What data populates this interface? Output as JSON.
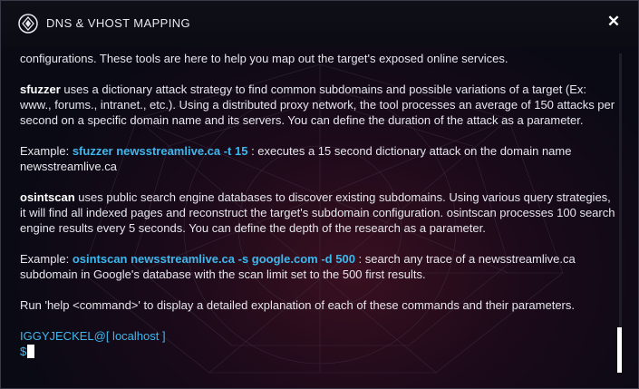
{
  "window": {
    "title": "DNS & VHOST MAPPING",
    "close_symbol": "✕"
  },
  "content": {
    "intro": "configurations. These tools are here to help you map out the target's exposed online services.",
    "sfuzzer": {
      "name": "sfuzzer",
      "desc": " uses a dictionary attack strategy to find common subdomains and possible variations of a target (Ex: www., forums., intranet., etc.). Using a distributed proxy network, the tool processes an average of 150 attacks per second on a specific domain name and its servers. You can define the duration of the attack as a parameter.",
      "example_label": "Example: ",
      "example_cmd": "sfuzzer newsstreamlive.ca -t 15",
      "example_desc": " : executes a 15 second dictionary attack on the domain name newsstreamlive.ca"
    },
    "osintscan": {
      "name": "osintscan",
      "desc": " uses public search engine databases to discover existing subdomains. Using various query strategies, it will find all indexed pages and reconstruct the target's subdomain configuration. osintscan processes 100 search engine results every 5 seconds. You can define the depth of the research as a parameter.",
      "example_label": "Example: ",
      "example_cmd": "osintscan newsstreamlive.ca -s google.com -d 500",
      "example_desc": " : search any trace of a newsstreamlive.ca subdomain in Google's database with the scan limit set to the 500 first results."
    },
    "help_hint": "Run 'help <command>' to display a detailed explanation of each of these commands and their parameters."
  },
  "terminal": {
    "prompt_user": "IGGYJECKEL@[ localhost ]",
    "prompt_symbol": "$",
    "input_value": ""
  },
  "colors": {
    "accent": "#3db8ee",
    "text": "#e6e6ec",
    "background": "#0a0a14"
  }
}
